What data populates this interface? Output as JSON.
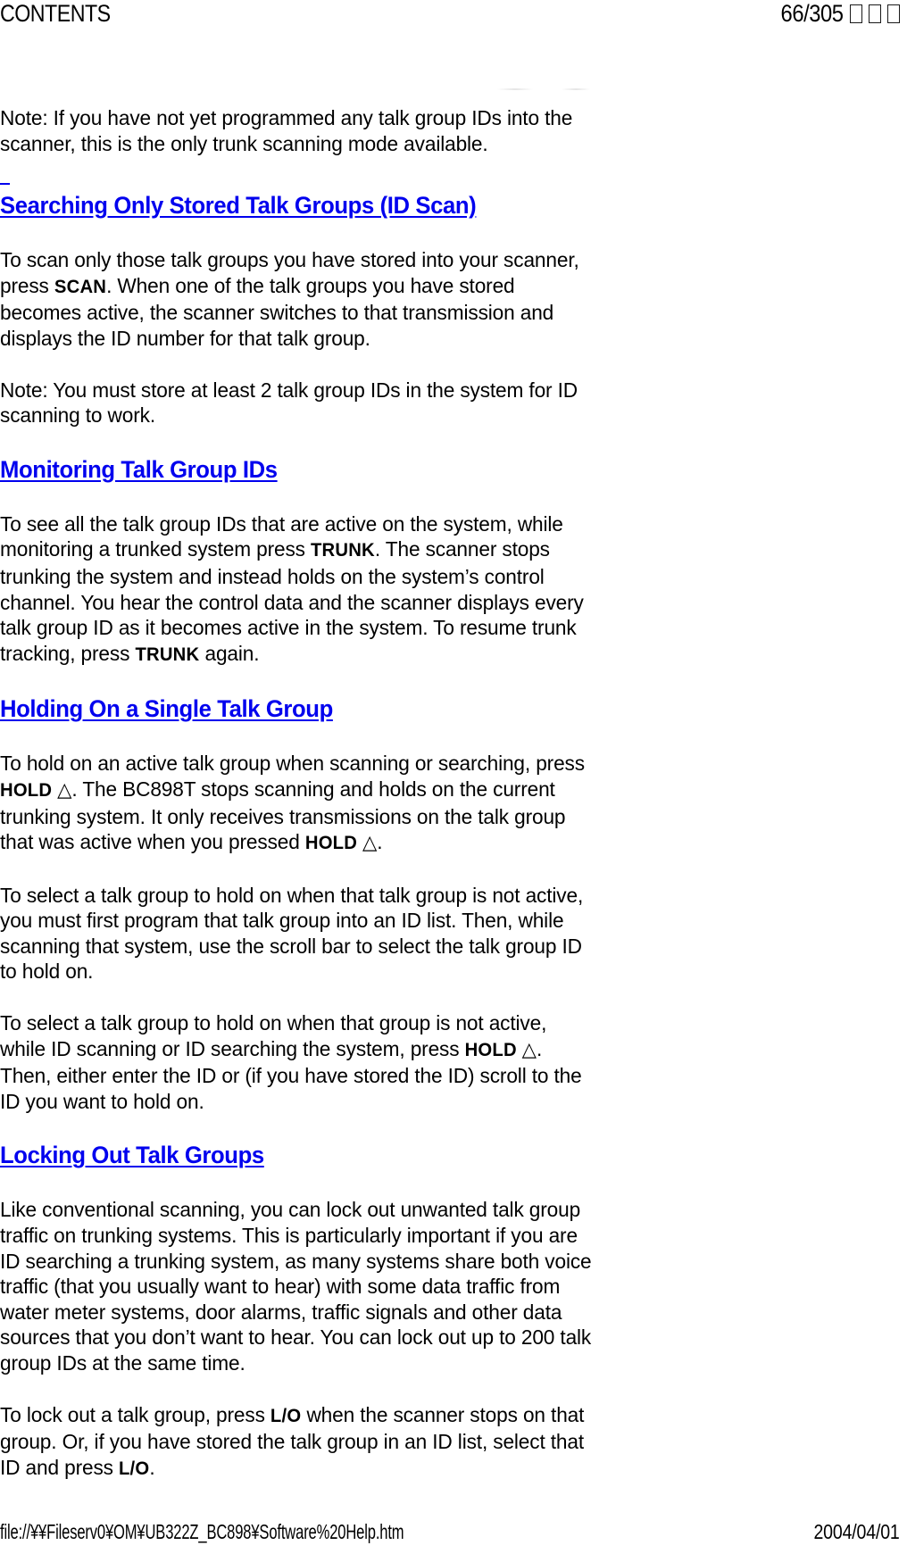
{
  "header": {
    "left_label": "CONTENTS",
    "page_indicator": "66/305",
    "missing_glyph_count": 3
  },
  "footer": {
    "file_path": "file://¥¥Fileserv0¥OM¥UB322Z_BC898¥Software%20Help.htm",
    "date": "2004/04/01"
  },
  "document": {
    "blocks": [
      {
        "type": "paragraph",
        "id": "note_trunk_mode",
        "text": "Note: If you have not yet programmed any talk group IDs into the scanner, this is the only trunk scanning mode available."
      },
      {
        "type": "heading",
        "id": "heading_id_scan",
        "text": "Searching Only Stored Talk Groups (ID Scan)",
        "color": "#0000ee",
        "has_anchor_mark": true
      },
      {
        "type": "paragraph",
        "id": "para_id_scan_1",
        "segments": [
          {
            "t": "To scan only those talk groups you have stored into your scanner, press "
          },
          {
            "t": "SCAN",
            "style": "key"
          },
          {
            "t": ". When one of the talk groups you have stored becomes active, the scanner switches to that transmission and displays the ID number for that talk group."
          }
        ]
      },
      {
        "type": "paragraph",
        "id": "note_two_ids",
        "text": "Note: You must store at least 2 talk group IDs in the system for ID scanning to work."
      },
      {
        "type": "heading",
        "id": "heading_monitoring",
        "text": "Monitoring Talk Group IDs",
        "color": "#0000ee",
        "has_anchor_mark": false
      },
      {
        "type": "paragraph",
        "id": "para_monitoring_1",
        "segments": [
          {
            "t": "To see all the talk group IDs that are active on the system, while monitoring a trunked system press "
          },
          {
            "t": "TRUNK",
            "style": "key"
          },
          {
            "t": ". The scanner stops trunking the system and instead holds on the system’s control channel. You hear the control data and the scanner displays every talk group ID as it becomes active in the system. To resume trunk tracking, press "
          },
          {
            "t": "TRUNK",
            "style": "key"
          },
          {
            "t": " again."
          }
        ]
      },
      {
        "type": "heading",
        "id": "heading_holding",
        "text": "Holding On a Single Talk Group",
        "color": "#0000ee",
        "has_anchor_mark": false
      },
      {
        "type": "paragraph",
        "id": "para_holding_1",
        "segments": [
          {
            "t": "To hold on an active talk group when scanning or searching, press "
          },
          {
            "t": "HOLD",
            "style": "key"
          },
          {
            "t": " △",
            "style": "tri"
          },
          {
            "t": ". The BC898T stops scanning and holds on the current trunking system. It only receives transmissions on the talk group that was active when you pressed "
          },
          {
            "t": "HOLD",
            "style": "key"
          },
          {
            "t": " △",
            "style": "tri"
          },
          {
            "t": "."
          }
        ]
      },
      {
        "type": "paragraph",
        "id": "para_holding_2",
        "text": "To select a talk group to hold on when that talk group is not active, you must first program that talk group into an ID list. Then, while scanning that system, use the scroll bar to select the talk group ID to hold on."
      },
      {
        "type": "paragraph",
        "id": "para_holding_3",
        "segments": [
          {
            "t": "To select a talk group to hold on when that group is not active, while ID scanning or ID searching the system, press "
          },
          {
            "t": "HOLD",
            "style": "key"
          },
          {
            "t": " △",
            "style": "tri"
          },
          {
            "t": ". Then, either enter the ID or (if you have stored the ID) scroll to the ID you want to hold on."
          }
        ]
      },
      {
        "type": "heading",
        "id": "heading_locking",
        "text": "Locking Out Talk Groups",
        "color": "#0000ee",
        "has_anchor_mark": false
      },
      {
        "type": "paragraph",
        "id": "para_locking_1",
        "text": "Like conventional scanning, you can lock out unwanted talk group traffic on trunking systems. This is particularly important if you are ID searching a trunking system, as many systems share both voice traffic (that you usually want to hear) with some data traffic from water meter systems, door alarms, traffic signals and other data sources that you don’t want to hear. You can lock out up to 200 talk group IDs at the same time."
      },
      {
        "type": "paragraph",
        "id": "para_locking_2",
        "segments": [
          {
            "t": "To lock out a talk group, press "
          },
          {
            "t": "L/O",
            "style": "key"
          },
          {
            "t": " when the scanner stops on that group. Or, if you have stored the talk group in an ID list, select that ID and press "
          },
          {
            "t": "L/O",
            "style": "key"
          },
          {
            "t": "."
          }
        ]
      }
    ]
  }
}
